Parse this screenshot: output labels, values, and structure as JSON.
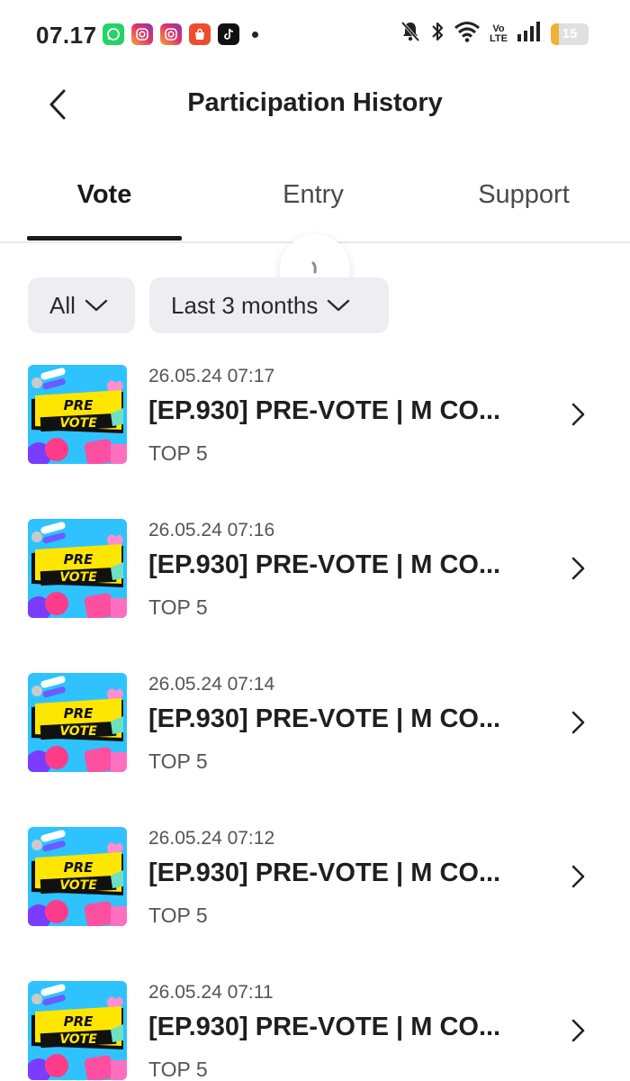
{
  "status_bar": {
    "time": "07.17",
    "apps": [
      "whatsapp-icon",
      "instagram-icon",
      "instagram-icon",
      "shopee-icon",
      "tiktok-icon"
    ],
    "volte_top": "Vo",
    "volte_bottom": "LTE",
    "battery_level": "15"
  },
  "header": {
    "title": "Participation History"
  },
  "tabs": [
    {
      "label": "Vote",
      "active": true
    },
    {
      "label": "Entry",
      "active": false
    },
    {
      "label": "Support",
      "active": false
    }
  ],
  "filters": {
    "type": "All",
    "range": "Last 3 months"
  },
  "thumb_text": {
    "line1": "PRE",
    "line2": "VOTE"
  },
  "items": [
    {
      "date": "26.05.24 07:17",
      "title": "[EP.930] PRE-VOTE | M CO...",
      "rank": "TOP 5"
    },
    {
      "date": "26.05.24 07:16",
      "title": "[EP.930] PRE-VOTE | M CO...",
      "rank": "TOP 5"
    },
    {
      "date": "26.05.24 07:14",
      "title": "[EP.930] PRE-VOTE | M CO...",
      "rank": "TOP 5"
    },
    {
      "date": "26.05.24 07:12",
      "title": "[EP.930] PRE-VOTE | M CO...",
      "rank": "TOP 5"
    },
    {
      "date": "26.05.24 07:11",
      "title": "[EP.930] PRE-VOTE | M CO...",
      "rank": "TOP 5"
    }
  ],
  "colors": {
    "text": "#1f1f1f",
    "chip_bg": "#eeeef2",
    "thumb_bg": "#2ec3ff",
    "thumb_banner": "#ffe600"
  }
}
